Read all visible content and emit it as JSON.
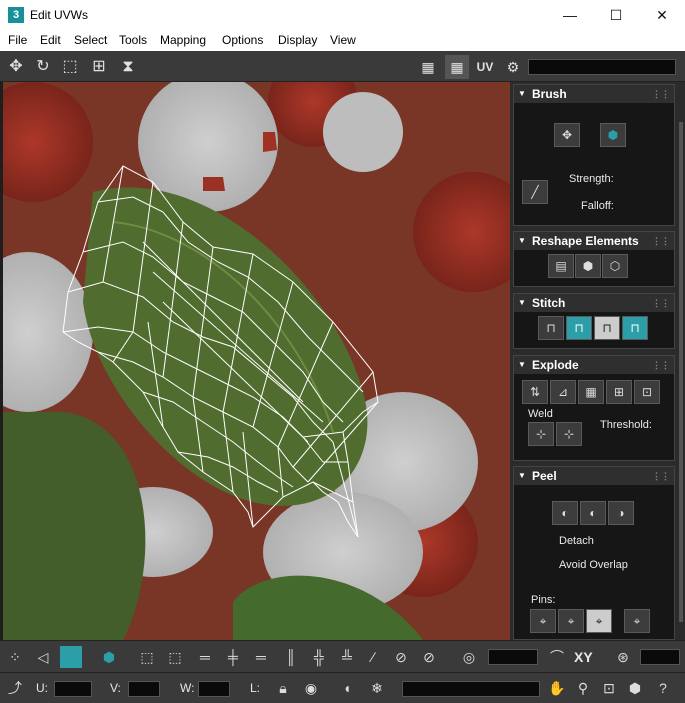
{
  "window": {
    "app_icon": "3",
    "title": "Edit UVWs",
    "minimize": "—",
    "maximize": "☐",
    "close": "✕"
  },
  "menu": [
    "File",
    "Edit",
    "Select",
    "Tools",
    "Mapping",
    "Options",
    "Display",
    "View"
  ],
  "toolbar": {
    "uv_label": "UV",
    "icons": [
      "move-icon",
      "rotate-icon",
      "scale-icon",
      "freeform-icon",
      "mirror-icon",
      "checker-icon",
      "checker-map-icon",
      "uv-toggle",
      "settings-icon"
    ]
  },
  "panel": {
    "brush": {
      "title": "Brush",
      "strength_label": "Strength:",
      "falloff_label": "Falloff:"
    },
    "reshape": {
      "title": "Reshape Elements"
    },
    "stitch": {
      "title": "Stitch"
    },
    "explode": {
      "title": "Explode",
      "weld_label": "Weld",
      "threshold_label": "Threshold:"
    },
    "peel": {
      "title": "Peel",
      "detach_label": "Detach",
      "avoid_overlap_label": "Avoid Overlap",
      "pins_label": "Pins:"
    }
  },
  "bottom": {
    "xy_label": "XY",
    "u_label": "U:",
    "v_label": "V:",
    "w_label": "W:",
    "l_label": "L:",
    "u_value": "",
    "v_value": "",
    "w_value": ""
  },
  "colors": {
    "accent": "#2b9ea8",
    "panel": "#161616"
  }
}
